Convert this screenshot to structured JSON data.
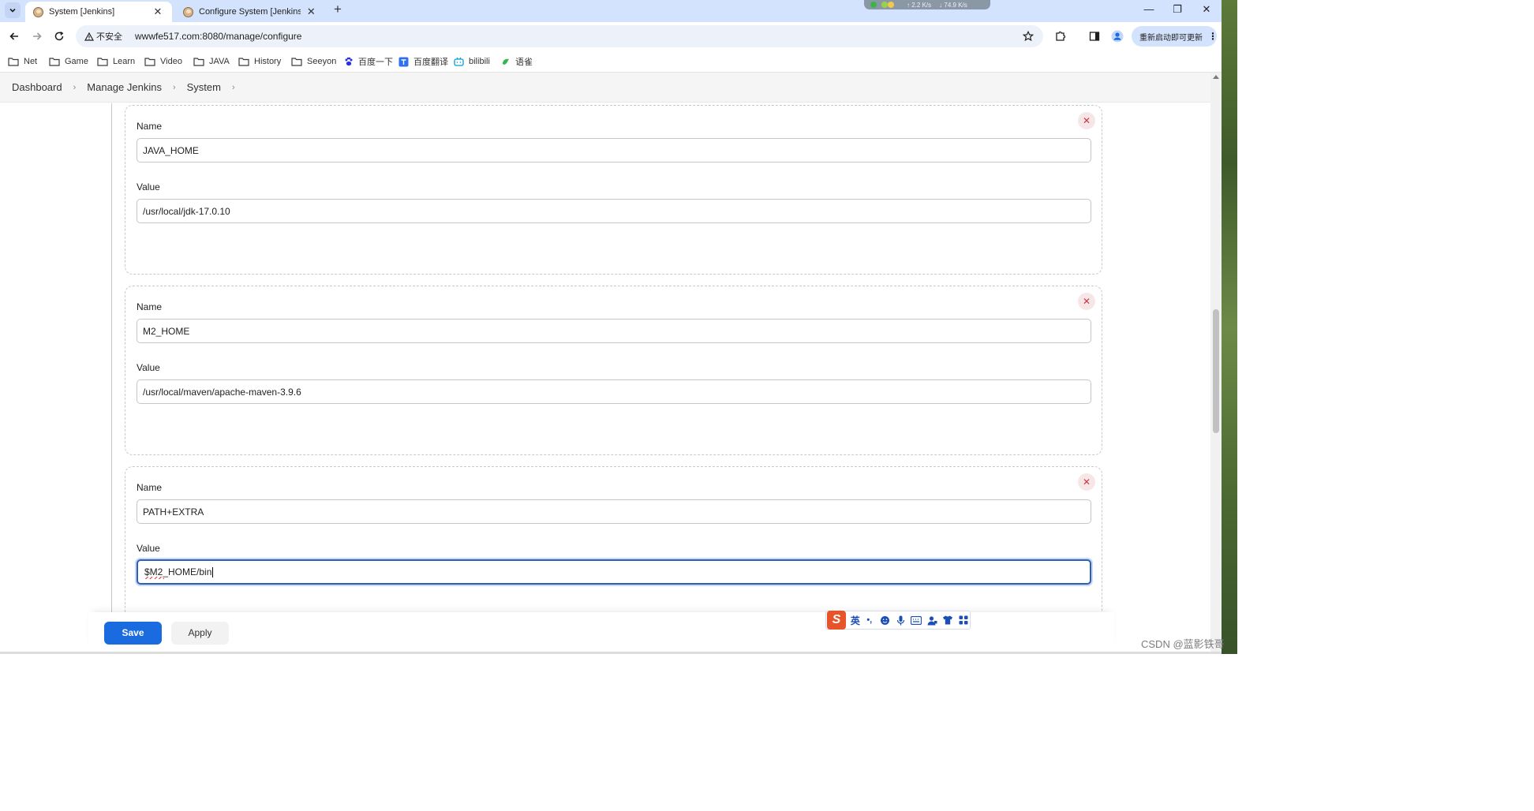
{
  "browser": {
    "tabs": [
      {
        "title": "System [Jenkins]",
        "active": true
      },
      {
        "title": "Configure System [Jenkins]",
        "active": false
      }
    ],
    "network_widget": {
      "upload": "2.2",
      "upload_unit": "K/s",
      "download": "74.9",
      "download_unit": "K/s"
    },
    "window_controls": {
      "minimize": "—",
      "restore": "❐",
      "close": "✕"
    },
    "tab_close_glyph": "✕",
    "new_tab_glyph": "+",
    "security_label": "不安全",
    "url": "wwwfe517.com:8080/manage/configure",
    "update_label": "重新启动即可更新",
    "update_kebab": "⋮"
  },
  "bookmarks": [
    {
      "label": "Net",
      "icon": "folder-icon"
    },
    {
      "label": "Game",
      "icon": "folder-icon"
    },
    {
      "label": "Learn",
      "icon": "folder-icon"
    },
    {
      "label": "Video",
      "icon": "folder-icon"
    },
    {
      "label": "JAVA",
      "icon": "folder-icon"
    },
    {
      "label": "History",
      "icon": "folder-icon"
    },
    {
      "label": "Seeyon",
      "icon": "folder-icon"
    },
    {
      "label": "百度一下",
      "icon": "baidu-paw-icon"
    },
    {
      "label": "百度翻译",
      "icon": "baidu-translate-icon"
    },
    {
      "label": "bilibili",
      "icon": "bilibili-tv-icon"
    },
    {
      "label": "语雀",
      "icon": "yuque-bird-icon"
    }
  ],
  "breadcrumb": {
    "items": [
      "Dashboard",
      "Manage Jenkins",
      "System"
    ],
    "separator": "›"
  },
  "env_vars": [
    {
      "name_label": "Name",
      "name": "JAVA_HOME",
      "value_label": "Value",
      "value": "/usr/local/jdk-17.0.10"
    },
    {
      "name_label": "Name",
      "name": "M2_HOME",
      "value_label": "Value",
      "value": "/usr/local/maven/apache-maven-3.9.6"
    },
    {
      "name_label": "Name",
      "name": "PATH+EXTRA",
      "value_label": "Value",
      "value": "$M2_HOME/bin"
    }
  ],
  "delete_glyph": "✕",
  "actions": {
    "save": "Save",
    "apply": "Apply"
  },
  "ime": {
    "logo": "S",
    "lang": "英",
    "punct": "•,"
  },
  "watermark": "CSDN @蓝影铁哥",
  "colors": {
    "primary_button": "#1a6ae0",
    "delete_icon": "#d0343f",
    "tab_strip": "#d3e3fd",
    "focus_ring": "#2e5fb3"
  }
}
